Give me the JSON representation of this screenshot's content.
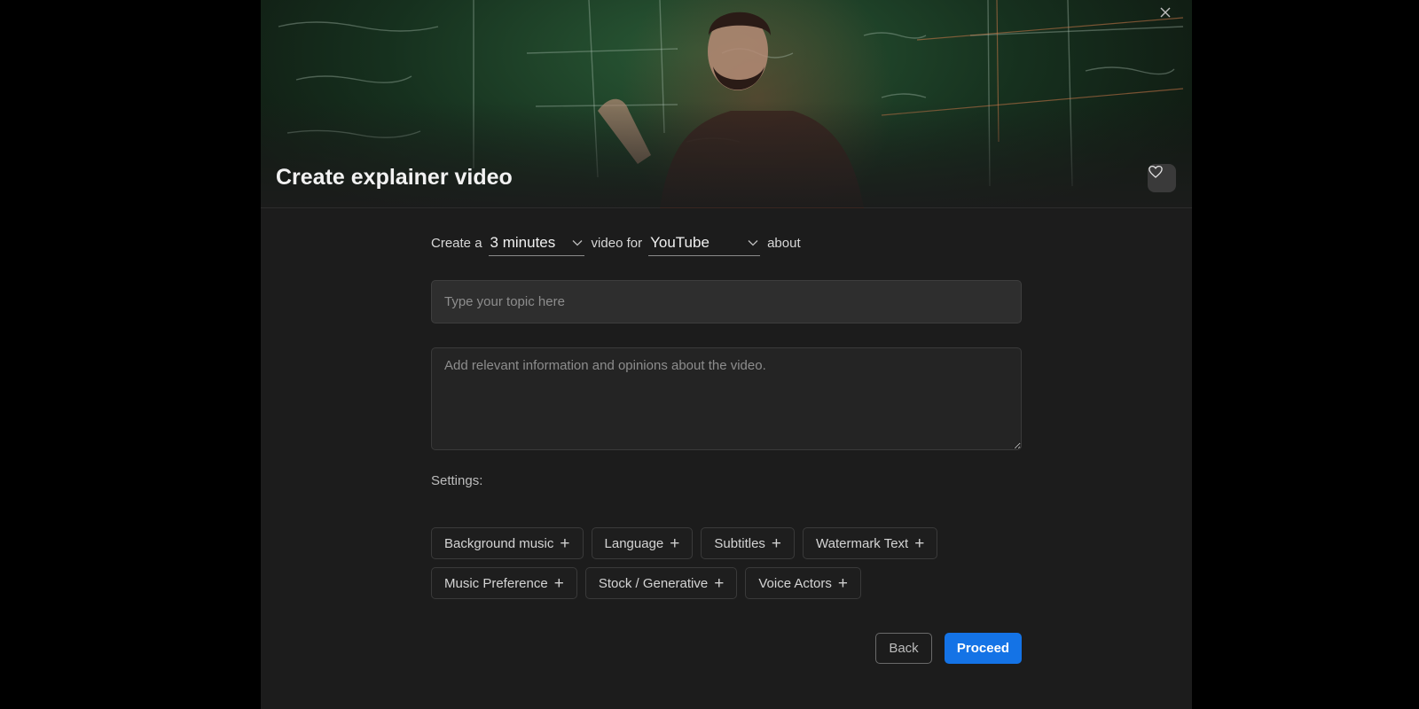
{
  "header": {
    "title": "Create explainer video",
    "favorite_icon": "heart-icon",
    "close_icon": "close-icon"
  },
  "form": {
    "sentence": {
      "prefix": "Create a",
      "duration_value": "3 minutes",
      "middle": "video for",
      "platform_value": "YouTube",
      "suffix": "about"
    },
    "topic_placeholder": "Type your topic here",
    "info_placeholder": "Add relevant information and opinions about the video.",
    "settings_label": "Settings:",
    "settings_chips_row1": [
      "Background music",
      "Language",
      "Subtitles",
      "Watermark Text"
    ],
    "settings_chips_row2": [
      "Music Preference",
      "Stock / Generative",
      "Voice Actors"
    ],
    "chip_icon": "plus-icon"
  },
  "actions": {
    "back_label": "Back",
    "proceed_label": "Proceed"
  },
  "colors": {
    "primary": "#1473e6",
    "background": "#1c1c1c",
    "input_bg": "#2e2e2e"
  }
}
